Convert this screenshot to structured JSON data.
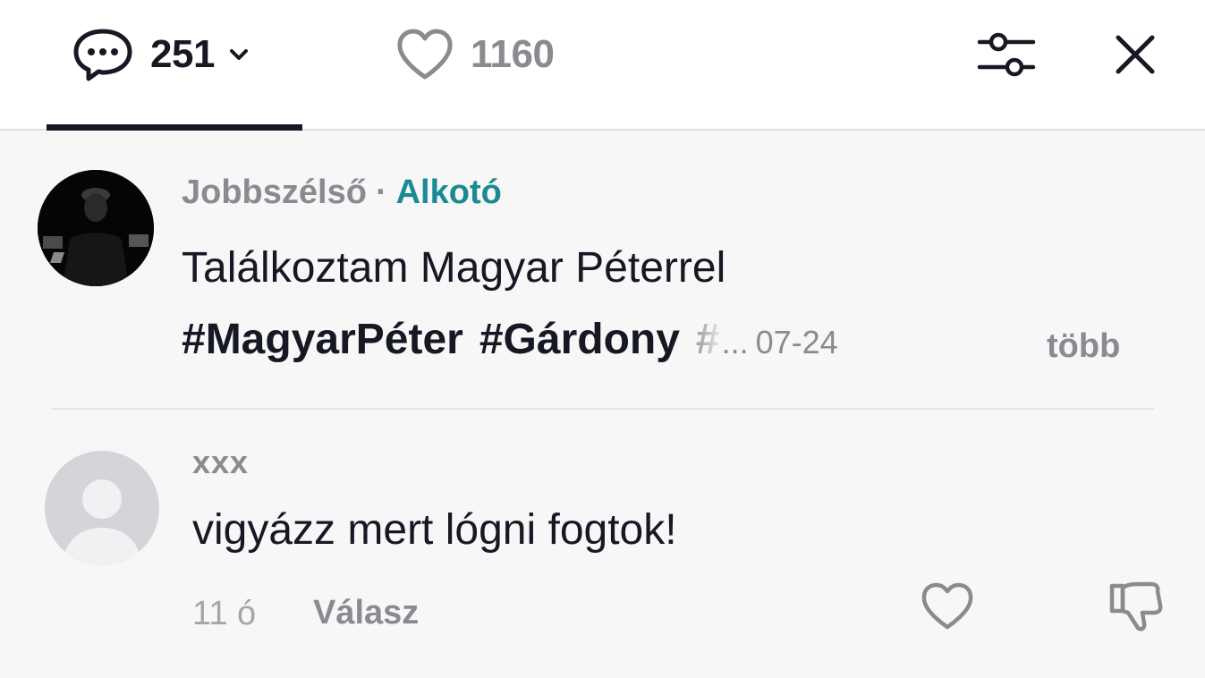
{
  "header": {
    "comment_count": "251",
    "like_count": "1160",
    "active_tab": "comments"
  },
  "comments": [
    {
      "author": "Jobbszélső",
      "separator": "·",
      "role": "Alkotó",
      "text": "Találkoztam Magyar Péterrel",
      "hashtags": [
        "#MagyarPéter",
        "#Gárdony",
        "#"
      ],
      "ellipsis": "...",
      "date": "07-24",
      "more_label": "több"
    },
    {
      "author": "xxx",
      "text": "vigyázz mert lógni fogtok!",
      "time": "11 ó",
      "reply_label": "Válasz"
    }
  ],
  "icons": {
    "comment": "comment-bubble-icon",
    "chevron": "chevron-down-icon",
    "heart": "heart-outline-icon",
    "filter": "sliders-icon",
    "close": "close-icon",
    "dislike": "thumbs-down-icon"
  },
  "colors": {
    "text_primary": "#161823",
    "text_secondary": "#8a8b91",
    "creator_accent": "#1b8a94",
    "background": "#f7f7f8"
  }
}
